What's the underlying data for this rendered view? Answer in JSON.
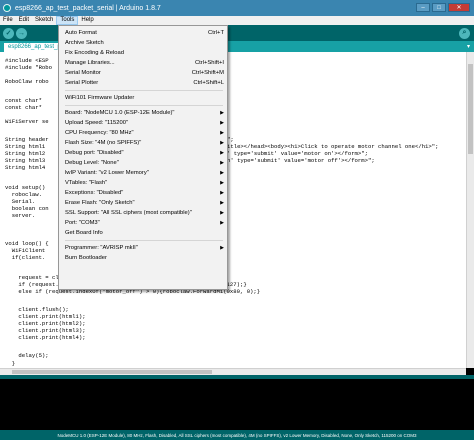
{
  "window": {
    "title": "esp8266_ap_test_packet_serial | Arduino 1.8.7"
  },
  "menubar": {
    "items": [
      "File",
      "Edit",
      "Sketch",
      "Tools",
      "Help"
    ]
  },
  "toolbar": {
    "verify": "✓",
    "upload": "→",
    "monitor": "⌕"
  },
  "tab": {
    "name": "esp8266_ap_test_packet_serial",
    "menu": "▾"
  },
  "tools_menu": {
    "auto_format": "Auto Format",
    "auto_format_sc": "Ctrl+T",
    "archive": "Archive Sketch",
    "fix_encoding": "Fix Encoding & Reload",
    "manage_libraries": "Manage Libraries...",
    "manage_libraries_sc": "Ctrl+Shift+I",
    "serial_monitor": "Serial Monitor",
    "serial_monitor_sc": "Ctrl+Shift+M",
    "serial_plotter": "Serial Plotter",
    "serial_plotter_sc": "Ctrl+Shift+L",
    "wifi_updater": "WiFi101 Firmware Updater",
    "board": "Board: \"NodeMCU 1.0 (ESP-12E Module)\"",
    "upload_speed": "Upload Speed: \"115200\"",
    "cpu_freq": "CPU Frequency: \"80 MHz\"",
    "flash_size": "Flash Size: \"4M (no SPIFFS)\"",
    "debug_port": "Debug port: \"Disabled\"",
    "debug_level": "Debug Level: \"None\"",
    "lwip": "lwIP Variant: \"v2 Lower Memory\"",
    "vtables": "VTables: \"Flash\"",
    "exceptions": "Exceptions: \"Disabled\"",
    "erase_flash": "Erase Flash: \"Only Sketch\"",
    "ssl": "SSL Support: \"All SSL ciphers (most compatible)\"",
    "port": "Port: \"COM3\"",
    "board_info": "Get Board Info",
    "programmer": "Programmer: \"AVRISP mkII\"",
    "burn_bootloader": "Burn Bootloader"
  },
  "code": {
    "l1": "#include <ESP",
    "l2": "#include \"Robo",
    "l3": "RoboClaw robo",
    "l4": "const char* ",
    "l5": "const char* ",
    "l6": "WiFiServer se",
    "l7": "String header",
    "l8": "String html1",
    "l9": "String html2",
    "l10": "String html3",
    "l11": "String html4",
    "l12": "void setup() ",
    "l13": "  roboclaw.",
    "l14": "  Serial.",
    "l15": "  boolean con",
    "l16": "  server.",
    "l17": "void loop() {",
    "l18": "  WiFiClient",
    "l19": "  if(client.",
    "l20": "    request = client.readStringUntil('\\r');",
    "l21": "    if (request.indexOf(\"motor_on\") > 0){roboclaw.ForwardM1(0x80, 127);}",
    "l22": "    else if (request.indexOf(\"motor_off\") > 0){roboclaw.ForwardM1(0x80, 0);}",
    "l23": "    client.flush();",
    "l24": "    client.print(html1);",
    "l25": "    client.print(html2);",
    "l26": "    client.print(html3);",
    "l27": "    client.print(html4);",
    "l28": "    delay(5);",
    "l29": "  }",
    "l30": "}",
    "r1": "\";",
    "r2": "itle></head><body><h1>Click to operate motor channel one</h1>\";",
    "r3": "' type='submit' value='motor on'></form>\";",
    "r4": "n' type='submit' value='motor off'></form>\";"
  },
  "status": {
    "text": "NodeMCU 1.0 (ESP-12E Module), 80 MHz, Flash, Disabled, All SSL ciphers (most compatible), 4M (no SPIFFS), v2 Lower Memory, Disabled, None, Only Sketch, 115200 on COM3"
  },
  "colors": {
    "toolbar": "#006468",
    "tabbar": "#17a1a5",
    "titlebar": "#3a85b0"
  }
}
